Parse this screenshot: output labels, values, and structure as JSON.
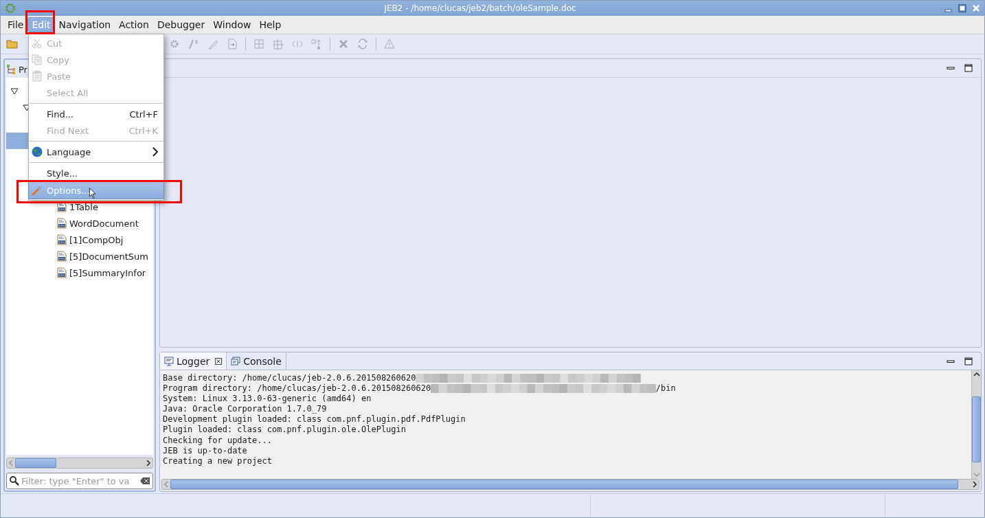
{
  "window": {
    "title": "JEB2 - /home/clucas/jeb2/batch/oleSample.doc"
  },
  "menubar": [
    {
      "label": "File",
      "open": false,
      "highlighted": false
    },
    {
      "label": "Edit",
      "open": true,
      "highlighted": true
    },
    {
      "label": "Navigation",
      "open": false,
      "highlighted": false
    },
    {
      "label": "Action",
      "open": false,
      "highlighted": false
    },
    {
      "label": "Debugger",
      "open": false,
      "highlighted": false
    },
    {
      "label": "Window",
      "open": false,
      "highlighted": false
    },
    {
      "label": "Help",
      "open": false,
      "highlighted": false
    }
  ],
  "edit_menu": [
    {
      "kind": "item",
      "label": "Cut",
      "disabled": true,
      "selected": false,
      "highlighted": false
    },
    {
      "kind": "item",
      "label": "Copy",
      "disabled": true,
      "selected": false,
      "highlighted": false
    },
    {
      "kind": "item",
      "label": "Paste",
      "disabled": true,
      "selected": false,
      "highlighted": false
    },
    {
      "kind": "item",
      "label": "Select All",
      "disabled": true,
      "selected": false,
      "highlighted": false
    },
    {
      "kind": "separator"
    },
    {
      "kind": "item",
      "label": "Find...",
      "shortcut": "Ctrl+F",
      "disabled": false,
      "selected": false,
      "highlighted": false
    },
    {
      "kind": "item",
      "label": "Find Next",
      "shortcut": "Ctrl+K",
      "disabled": true,
      "selected": false,
      "highlighted": false
    },
    {
      "kind": "separator"
    },
    {
      "kind": "submenu",
      "label": "Language",
      "disabled": false,
      "selected": false,
      "highlighted": false
    },
    {
      "kind": "separator"
    },
    {
      "kind": "item",
      "label": "Style...",
      "disabled": false,
      "selected": false,
      "highlighted": false
    },
    {
      "kind": "item",
      "label": "Options...",
      "disabled": false,
      "selected": true,
      "highlighted": true
    }
  ],
  "project_panel": {
    "tab": "Pr",
    "tree": [
      {
        "expanded": true,
        "selected": false,
        "children": [
          {
            "expanded": true,
            "selected": false,
            "children": [
              {
                "selected": true,
                "children": [
                  {
                    "label": "1Table",
                    "selected": false
                  },
                  {
                    "label": "WordDocument",
                    "selected": false
                  },
                  {
                    "label": "[1]CompObj",
                    "selected": false
                  },
                  {
                    "label": "[5]DocumentSum",
                    "selected": false
                  },
                  {
                    "label": "[5]SummaryInfor",
                    "selected": false
                  }
                ]
              }
            ]
          }
        ]
      }
    ],
    "filter": {
      "placeholder": "Filter: type \"Enter\" to va"
    }
  },
  "bottom_panel": {
    "tabs": [
      {
        "label": "Logger",
        "closable": true,
        "selected": true
      },
      {
        "label": "Console",
        "closable": false,
        "selected": false
      }
    ],
    "log": [
      {
        "text": "Base directory: /home/clucas/jeb-2.0.6.201508260620",
        "redacted": true
      },
      {
        "text": "Program directory: /home/clucas/jeb-2.0.6.201508260620",
        "redacted": true,
        "after": "/bin"
      },
      {
        "text": "System: Linux 3.13.0-63-generic (amd64) en",
        "redacted": false
      },
      {
        "text": "Java: Oracle Corporation 1.7.0_79",
        "redacted": false
      },
      {
        "text": "Development plugin loaded: class com.pnf.plugin.pdf.PdfPlugin",
        "redacted": false
      },
      {
        "text": "Plugin loaded: class com.pnf.plugin.ole.OlePlugin",
        "redacted": false
      },
      {
        "text": "Checking for update...",
        "redacted": false
      },
      {
        "text": "JEB is up-to-date",
        "redacted": false
      },
      {
        "text": "Creating a new project",
        "redacted": false
      }
    ]
  }
}
